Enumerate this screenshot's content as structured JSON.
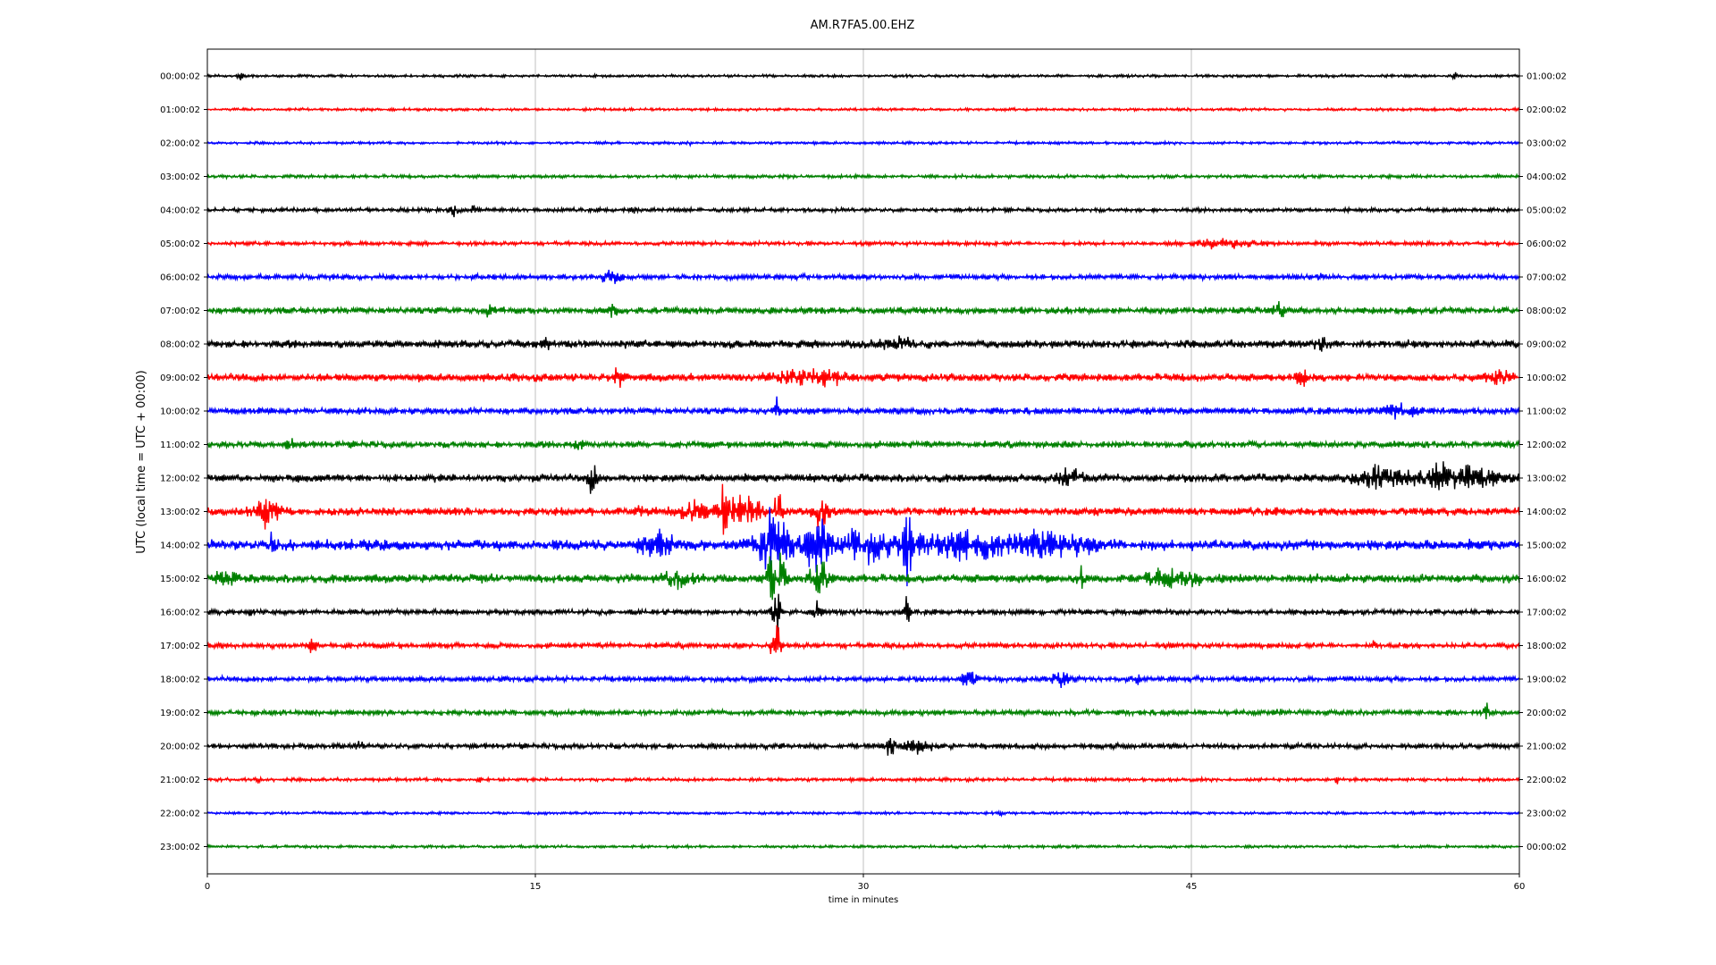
{
  "chart_data": {
    "type": "line",
    "title": "AM.R7FA5.00.EHZ",
    "xlabel": "time in minutes",
    "ylabel": "UTC (local time = UTC + 00:00)",
    "xlim": [
      0,
      60
    ],
    "x_ticks": [
      0,
      15,
      30,
      45,
      60
    ],
    "vertical_grid_at": [
      15,
      30,
      45
    ],
    "left_tick_labels": [
      "00:00:02",
      "01:00:02",
      "02:00:02",
      "03:00:02",
      "04:00:02",
      "05:00:02",
      "06:00:02",
      "07:00:02",
      "08:00:02",
      "09:00:02",
      "10:00:02",
      "11:00:02",
      "12:00:02",
      "13:00:02",
      "14:00:02",
      "15:00:02",
      "16:00:02",
      "17:00:02",
      "18:00:02",
      "19:00:02",
      "20:00:02",
      "21:00:02",
      "22:00:02",
      "23:00:02"
    ],
    "right_tick_labels": [
      "01:00:02",
      "02:00:02",
      "03:00:02",
      "04:00:02",
      "05:00:02",
      "06:00:02",
      "07:00:02",
      "08:00:02",
      "09:00:02",
      "10:00:02",
      "11:00:02",
      "12:00:02",
      "13:00:02",
      "14:00:02",
      "15:00:02",
      "16:00:02",
      "17:00:02",
      "18:00:02",
      "19:00:02",
      "20:00:02",
      "21:00:02",
      "22:00:02",
      "23:00:02",
      "00:00:02"
    ],
    "trace_colors": [
      "#000000",
      "#ff0000",
      "#0000ff",
      "#008000"
    ],
    "traces": [
      {
        "noise": 0.4,
        "events": [
          {
            "t": 1.5,
            "amp": 1.5,
            "dur": 0.1
          },
          {
            "t": 57,
            "amp": 1.5,
            "dur": 0.1
          }
        ]
      },
      {
        "noise": 0.4,
        "events": []
      },
      {
        "noise": 0.4,
        "events": [
          {
            "t": 22,
            "amp": 1.0,
            "dur": 0.1
          }
        ]
      },
      {
        "noise": 0.5,
        "events": []
      },
      {
        "noise": 0.6,
        "events": [
          {
            "t": 11.3,
            "amp": 2.0,
            "dur": 0.2
          },
          {
            "t": 12.2,
            "amp": 1.5,
            "dur": 0.1
          },
          {
            "t": 19.5,
            "amp": 1.5,
            "dur": 0.1
          }
        ]
      },
      {
        "noise": 0.6,
        "events": [
          {
            "t": 46.5,
            "amp": 1.2,
            "dur": 2.0
          }
        ]
      },
      {
        "noise": 0.8,
        "events": [
          {
            "t": 18.5,
            "amp": 2.0,
            "dur": 0.6
          },
          {
            "t": 51,
            "amp": 1.5,
            "dur": 0.2
          }
        ]
      },
      {
        "noise": 1.0,
        "events": [
          {
            "t": 12.8,
            "amp": 2.0,
            "dur": 0.2
          },
          {
            "t": 18.5,
            "amp": 2.5,
            "dur": 0.2
          },
          {
            "t": 49,
            "amp": 2.0,
            "dur": 0.4
          }
        ]
      },
      {
        "noise": 1.2,
        "events": [
          {
            "t": 15.5,
            "amp": 2.0,
            "dur": 0.2
          },
          {
            "t": 31.5,
            "amp": 1.5,
            "dur": 1.0
          },
          {
            "t": 51,
            "amp": 1.8,
            "dur": 0.3
          }
        ]
      },
      {
        "noise": 1.2,
        "events": [
          {
            "t": 18.8,
            "amp": 2.5,
            "dur": 0.2
          },
          {
            "t": 27.5,
            "amp": 2.5,
            "dur": 2.0
          },
          {
            "t": 50,
            "amp": 2.5,
            "dur": 0.4
          },
          {
            "t": 59,
            "amp": 2.0,
            "dur": 0.6
          }
        ]
      },
      {
        "noise": 1.0,
        "events": [
          {
            "t": 26,
            "amp": 6.0,
            "dur": 0.1
          },
          {
            "t": 54.5,
            "amp": 2.0,
            "dur": 1.0
          }
        ]
      },
      {
        "noise": 1.0,
        "events": [
          {
            "t": 3.8,
            "amp": 2.0,
            "dur": 0.2
          },
          {
            "t": 17,
            "amp": 2.0,
            "dur": 0.2
          }
        ]
      },
      {
        "noise": 1.2,
        "events": [
          {
            "t": 17.6,
            "amp": 4.5,
            "dur": 0.2
          },
          {
            "t": 39.5,
            "amp": 2.0,
            "dur": 1.0
          },
          {
            "t": 53.5,
            "amp": 3.0,
            "dur": 1.5
          },
          {
            "t": 57,
            "amp": 4.0,
            "dur": 2.5
          }
        ]
      },
      {
        "noise": 1.2,
        "events": [
          {
            "t": 2.8,
            "amp": 5.0,
            "dur": 0.8
          },
          {
            "t": 20,
            "amp": 2.0,
            "dur": 0.4
          },
          {
            "t": 22.5,
            "amp": 2.5,
            "dur": 1.5
          },
          {
            "t": 23.7,
            "amp": 10.0,
            "dur": 0.2
          },
          {
            "t": 24.5,
            "amp": 4.5,
            "dur": 1.0
          },
          {
            "t": 26.1,
            "amp": 7.0,
            "dur": 0.2
          },
          {
            "t": 28,
            "amp": 5.0,
            "dur": 0.6
          }
        ]
      },
      {
        "noise": 1.6,
        "events": [
          {
            "t": 3,
            "amp": 3.0,
            "dur": 0.2
          },
          {
            "t": 20.5,
            "amp": 6.0,
            "dur": 0.8
          },
          {
            "t": 26,
            "amp": 10.0,
            "dur": 1.0
          },
          {
            "t": 27.9,
            "amp": 10.0,
            "dur": 0.6
          },
          {
            "t": 32,
            "amp": 9.0,
            "dur": 0.2
          },
          {
            "t": 30.5,
            "amp": 5.0,
            "dur": 2.0
          },
          {
            "t": 34.5,
            "amp": 4.5,
            "dur": 2.5
          },
          {
            "t": 38.5,
            "amp": 3.5,
            "dur": 2.5
          }
        ]
      },
      {
        "noise": 1.3,
        "events": [
          {
            "t": 0.8,
            "amp": 2.5,
            "dur": 0.5
          },
          {
            "t": 21.5,
            "amp": 2.0,
            "dur": 1.0
          },
          {
            "t": 26,
            "amp": 10.0,
            "dur": 0.5
          },
          {
            "t": 28,
            "amp": 5.0,
            "dur": 0.5
          },
          {
            "t": 40,
            "amp": 3.0,
            "dur": 0.2
          },
          {
            "t": 44,
            "amp": 2.0,
            "dur": 2.0
          }
        ]
      },
      {
        "noise": 0.8,
        "events": [
          {
            "t": 2,
            "amp": 1.5,
            "dur": 0.1
          },
          {
            "t": 26,
            "amp": 7.0,
            "dur": 0.2
          },
          {
            "t": 27.9,
            "amp": 4.0,
            "dur": 0.2
          },
          {
            "t": 32,
            "amp": 6.0,
            "dur": 0.1
          },
          {
            "t": 42.5,
            "amp": 1.8,
            "dur": 0.1
          }
        ]
      },
      {
        "noise": 0.8,
        "events": [
          {
            "t": 4.8,
            "amp": 2.0,
            "dur": 0.3
          },
          {
            "t": 26,
            "amp": 9.0,
            "dur": 0.2
          },
          {
            "t": 53.3,
            "amp": 1.8,
            "dur": 0.1
          }
        ]
      },
      {
        "noise": 0.8,
        "events": [
          {
            "t": 34.8,
            "amp": 2.5,
            "dur": 0.4
          },
          {
            "t": 39,
            "amp": 2.0,
            "dur": 0.6
          },
          {
            "t": 42.5,
            "amp": 2.5,
            "dur": 0.1
          }
        ]
      },
      {
        "noise": 0.8,
        "events": [
          {
            "t": 49,
            "amp": 1.8,
            "dur": 0.1
          },
          {
            "t": 58.5,
            "amp": 1.8,
            "dur": 0.2
          }
        ]
      },
      {
        "noise": 0.8,
        "events": [
          {
            "t": 7,
            "amp": 1.5,
            "dur": 0.2
          },
          {
            "t": 26.2,
            "amp": 2.0,
            "dur": 0.1
          },
          {
            "t": 31.3,
            "amp": 3.0,
            "dur": 0.3
          },
          {
            "t": 32.5,
            "amp": 2.0,
            "dur": 0.8
          }
        ]
      },
      {
        "noise": 0.5,
        "events": [
          {
            "t": 2.3,
            "amp": 1.0,
            "dur": 0.1
          },
          {
            "t": 12.4,
            "amp": 1.5,
            "dur": 0.1
          },
          {
            "t": 51.6,
            "amp": 1.5,
            "dur": 0.1
          }
        ]
      },
      {
        "noise": 0.4,
        "events": [
          {
            "t": 36.3,
            "amp": 1.0,
            "dur": 0.1
          }
        ]
      },
      {
        "noise": 0.4,
        "events": []
      }
    ]
  }
}
